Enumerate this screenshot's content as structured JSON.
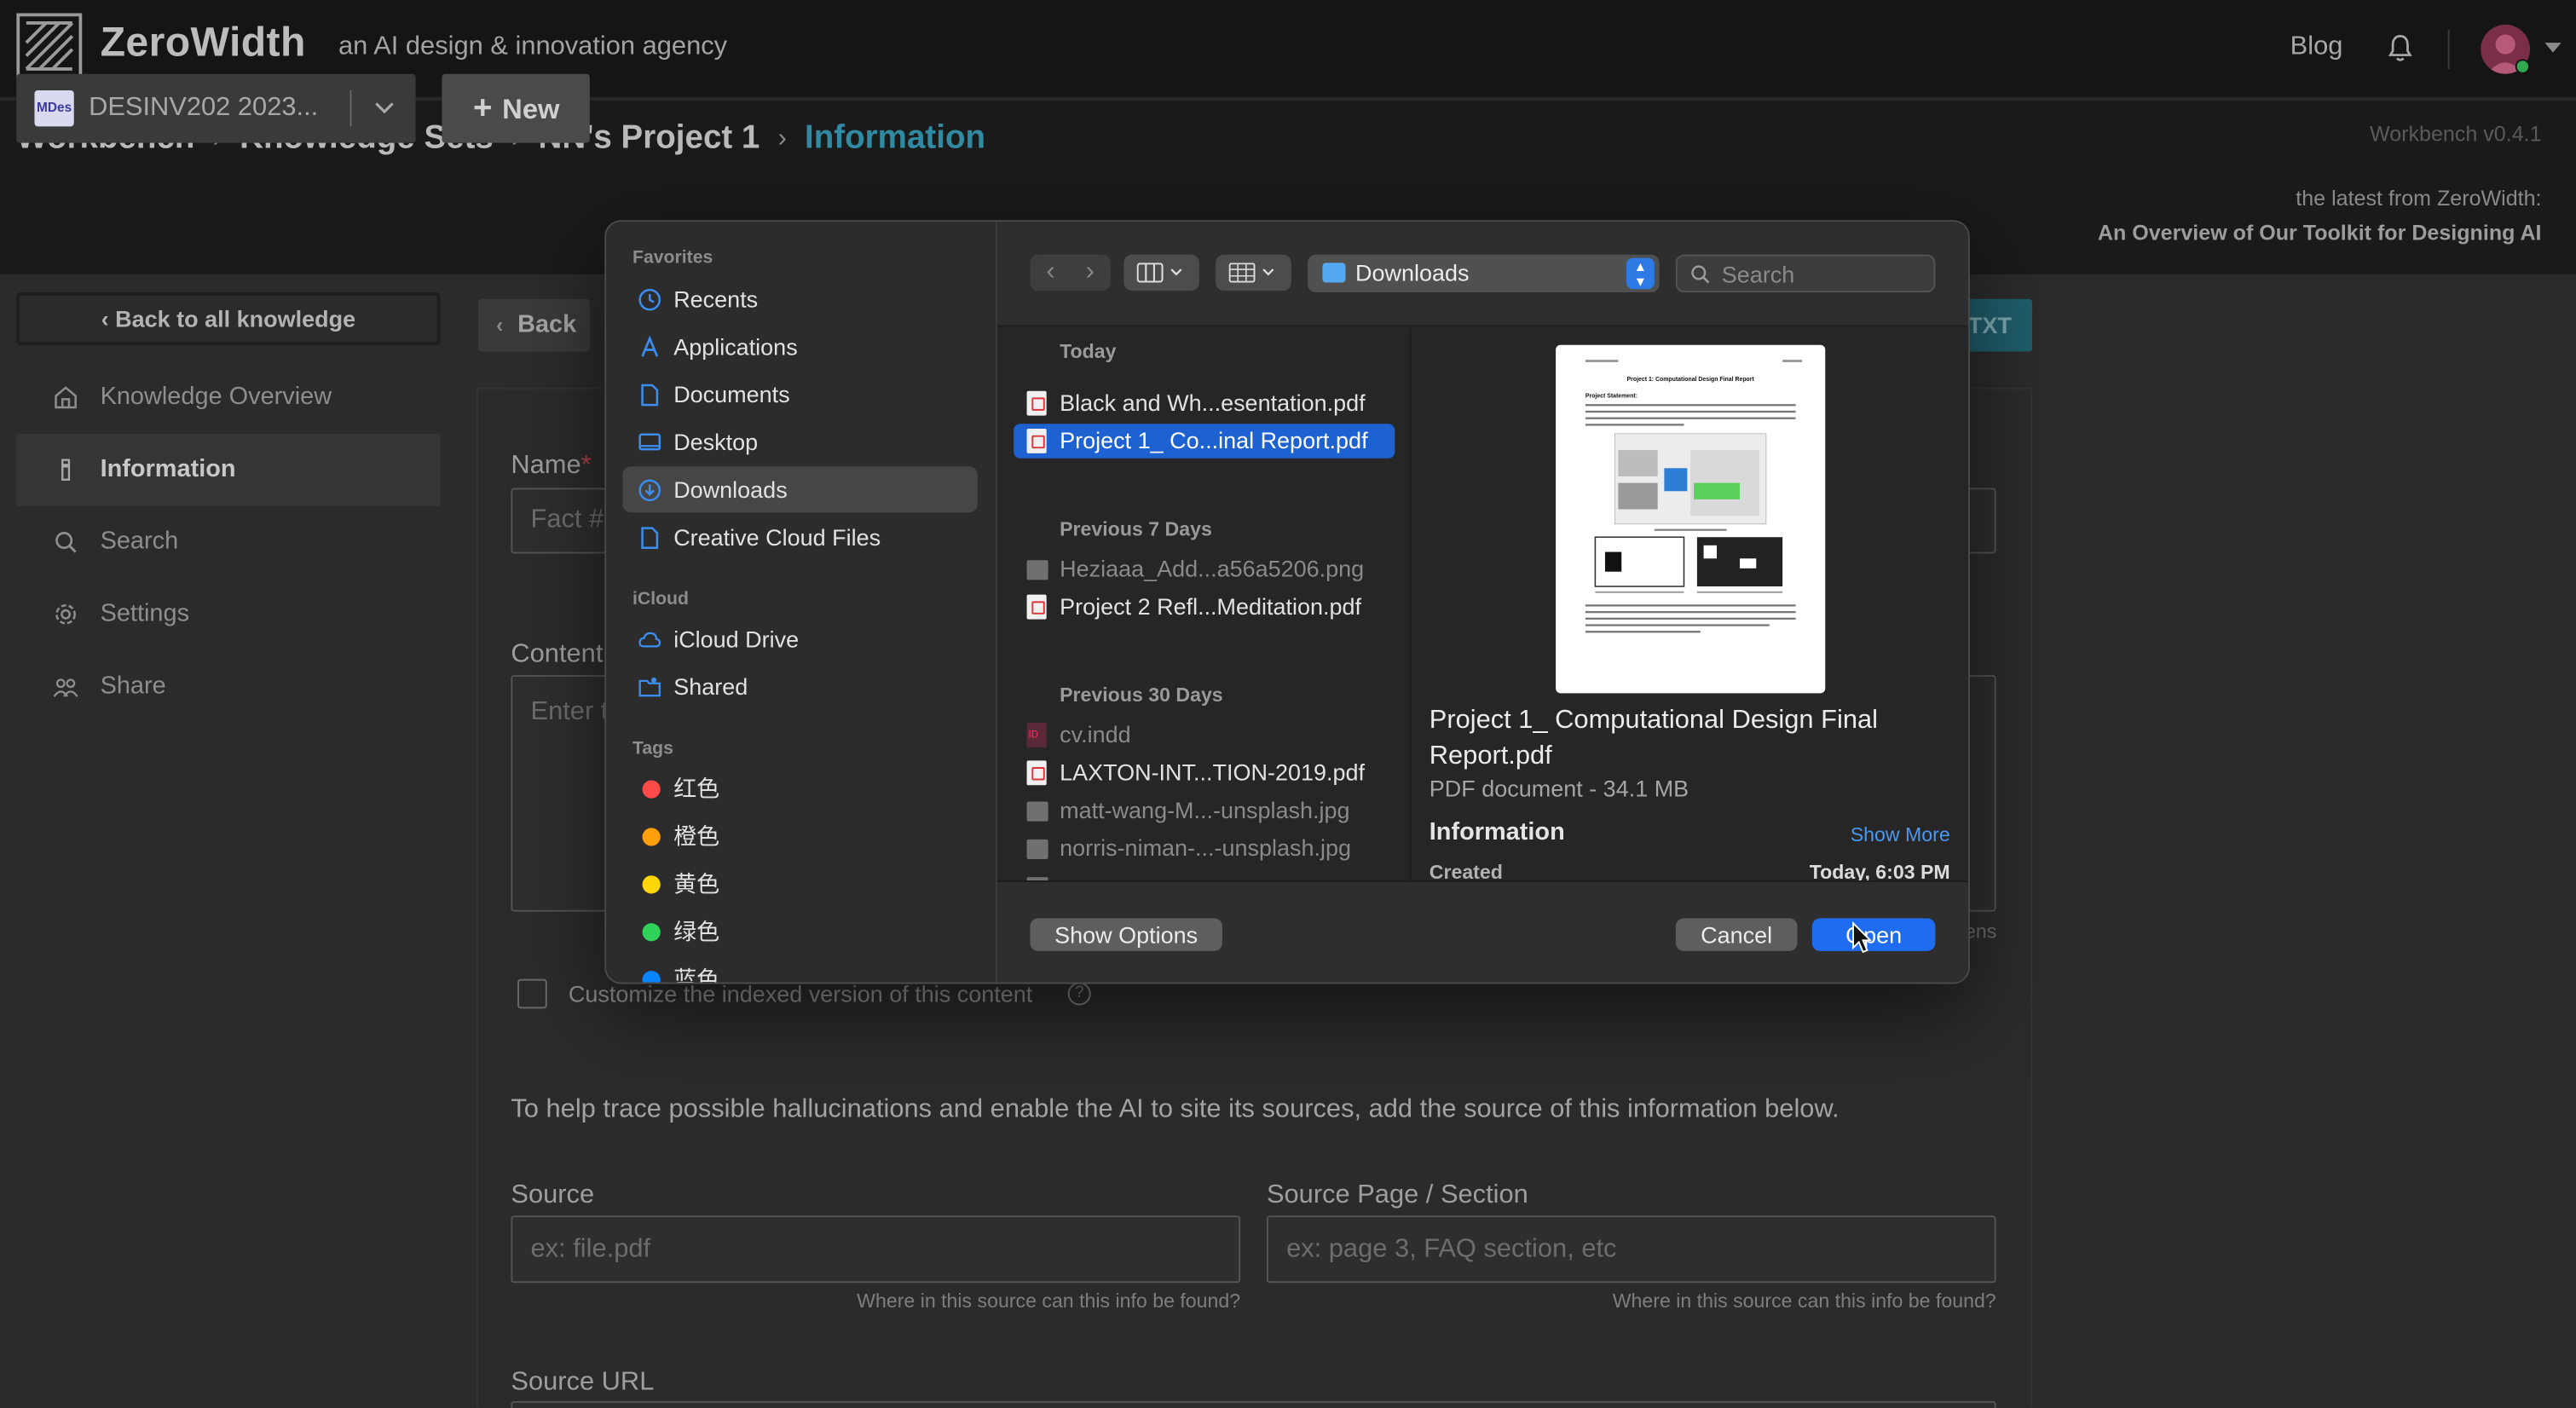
{
  "topnav": {
    "brand": "ZeroWidth",
    "tagline": "an AI design & innovation agency",
    "blog": "Blog"
  },
  "breadcrumb": {
    "items": [
      "Workbench",
      "Knowledge Sets",
      "NN's Project 1"
    ],
    "current": "Information"
  },
  "header": {
    "version": "Workbench v0.4.1",
    "latest_label": "the latest from ZeroWidth:",
    "latest_title": "An Overview of Our Toolkit for Designing AI",
    "project_badge": "MDes",
    "project_name": "DESINV202 2023...",
    "new_label": "New"
  },
  "sidebar": {
    "back_all": "Back to all knowledge",
    "items": [
      {
        "label": "Knowledge Overview",
        "icon": "home-icon"
      },
      {
        "label": "Information",
        "icon": "info-icon"
      },
      {
        "label": "Search",
        "icon": "search-icon"
      },
      {
        "label": "Settings",
        "icon": "gear-icon"
      },
      {
        "label": "Share",
        "icon": "people-icon"
      }
    ]
  },
  "main": {
    "back": "Back",
    "txt_button": "TXT",
    "name_label": "Name",
    "name_placeholder": "Fact #",
    "content_label": "Content",
    "content_placeholder": "Enter t",
    "tokens_text": "ens",
    "customize_text": "Customize the indexed version of this content",
    "trace_text": "To help trace possible hallucinations and enable the AI to site its sources, add the source of this information below.",
    "source_label": "Source",
    "source_placeholder": "ex: file.pdf",
    "source_hint": "Where in this source can this info be found?",
    "page_label": "Source Page / Section",
    "page_placeholder": "ex: page 3, FAQ section, etc",
    "page_hint": "Where in this source can this info be found?",
    "url_label": "Source URL"
  },
  "dialog": {
    "favorites_head": "Favorites",
    "favorites": [
      {
        "label": "Recents",
        "icon": "clock-icon"
      },
      {
        "label": "Applications",
        "icon": "applications-icon"
      },
      {
        "label": "Documents",
        "icon": "document-icon"
      },
      {
        "label": "Desktop",
        "icon": "desktop-icon"
      },
      {
        "label": "Downloads",
        "icon": "download-icon"
      },
      {
        "label": "Creative Cloud Files",
        "icon": "document-icon"
      }
    ],
    "icloud_head": "iCloud",
    "icloud": [
      {
        "label": "iCloud Drive",
        "icon": "cloud-icon"
      },
      {
        "label": "Shared",
        "icon": "shared-folder-icon"
      }
    ],
    "tags_head": "Tags",
    "tags": [
      {
        "label": "红色",
        "color": "#ff4a4a"
      },
      {
        "label": "橙色",
        "color": "#ff9f0a"
      },
      {
        "label": "黄色",
        "color": "#ffd60a"
      },
      {
        "label": "绿色",
        "color": "#30d158"
      },
      {
        "label": "蓝色",
        "color": "#0a84ff"
      }
    ],
    "location": "Downloads",
    "search_placeholder": "Search",
    "groups": [
      {
        "head": "Today",
        "files": [
          {
            "name": "Black and Wh...esentation.pdf",
            "type": "pdf"
          },
          {
            "name": "Project 1_ Co...inal Report.pdf",
            "type": "pdf",
            "selected": true
          }
        ]
      },
      {
        "head": "Previous 7 Days",
        "files": [
          {
            "name": "Heziaaa_Add...a56a5206.png",
            "type": "img",
            "dim": true
          },
          {
            "name": "Project 2 Refl...Meditation.pdf",
            "type": "pdf"
          }
        ]
      },
      {
        "head": "Previous 30 Days",
        "files": [
          {
            "name": "cv.indd",
            "type": "indd",
            "dim": true
          },
          {
            "name": "LAXTON-INT...TION-2019.pdf",
            "type": "pdf"
          },
          {
            "name": "matt-wang-M...-unsplash.jpg",
            "type": "img",
            "dim": true
          },
          {
            "name": "norris-niman-...-unsplash.jpg",
            "type": "img",
            "dim": true
          }
        ]
      }
    ],
    "preview": {
      "title": "Project 1_ Computational Design Final Report.pdf",
      "kind": "PDF document - 34.1 MB",
      "info_head": "Information",
      "show_more": "Show More",
      "created_label": "Created",
      "created_value": "Today, 6:03 PM",
      "doc_title": "Project 1: Computational Design Final Report",
      "doc_section": "Project Statement:"
    },
    "show_options": "Show Options",
    "cancel": "Cancel",
    "open": "Open"
  }
}
